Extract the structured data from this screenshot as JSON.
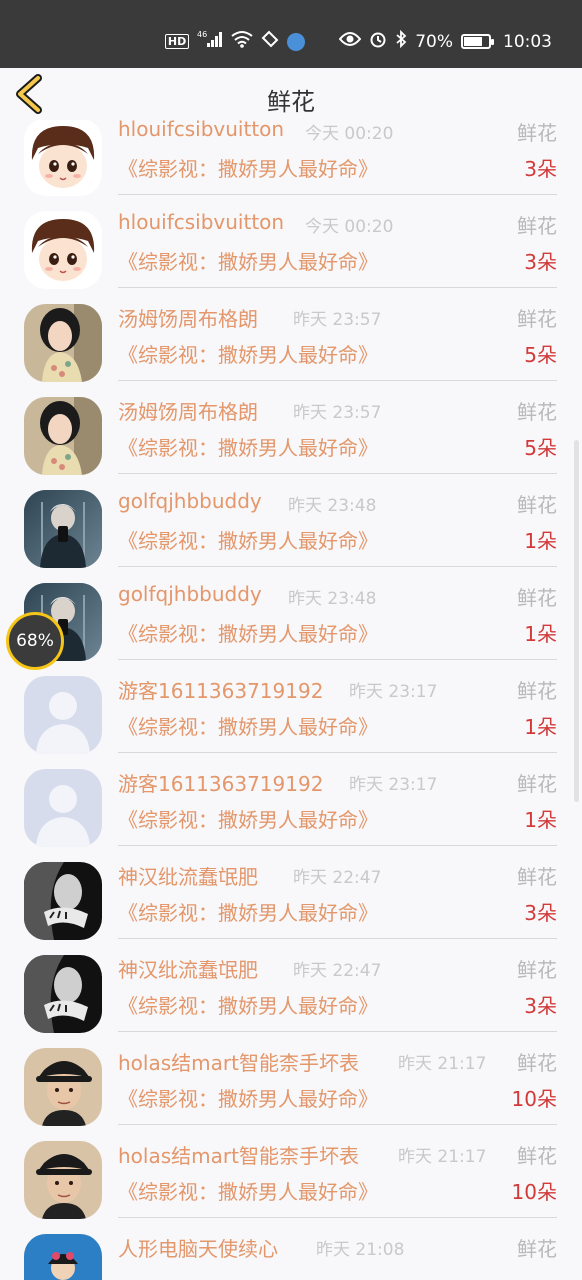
{
  "status_bar": {
    "hd": "HD",
    "net": "46",
    "battery_text": "70%",
    "time": "10:03",
    "battery_level": 0.7
  },
  "nav": {
    "title": "鲜花"
  },
  "overlay": {
    "float_percent": "68%"
  },
  "items": [
    {
      "name": "hlouifcsibvuitton",
      "time": "今天 00:20",
      "gift": "鲜花",
      "book": "《综影视：撒娇男人最好命》",
      "count": "3朵",
      "avatar": "cartoon"
    },
    {
      "name": "hlouifcsibvuitton",
      "time": "今天 00:20",
      "gift": "鲜花",
      "book": "《综影视：撒娇男人最好命》",
      "count": "3朵",
      "avatar": "cartoon"
    },
    {
      "name": "汤姆饧周布格朗",
      "time": "昨天 23:57",
      "gift": "鲜花",
      "book": "《综影视：撒娇男人最好命》",
      "count": "5朵",
      "avatar": "woman"
    },
    {
      "name": "汤姆饧周布格朗",
      "time": "昨天 23:57",
      "gift": "鲜花",
      "book": "《综影视：撒娇男人最好命》",
      "count": "5朵",
      "avatar": "woman"
    },
    {
      "name": "golfqjhbbuddy",
      "time": "昨天 23:48",
      "gift": "鲜花",
      "book": "《综影视：撒娇男人最好命》",
      "count": "1朵",
      "avatar": "mirror"
    },
    {
      "name": "golfqjhbbuddy",
      "time": "昨天 23:48",
      "gift": "鲜花",
      "book": "《综影视：撒娇男人最好命》",
      "count": "1朵",
      "avatar": "mirror"
    },
    {
      "name": "游客1611363719192",
      "time": "昨天 23:17",
      "gift": "鲜花",
      "book": "《综影视：撒娇男人最好命》",
      "count": "1朵",
      "avatar": "default"
    },
    {
      "name": "游客1611363719192",
      "time": "昨天 23:17",
      "gift": "鲜花",
      "book": "《综影视：撒娇男人最好命》",
      "count": "1朵",
      "avatar": "default"
    },
    {
      "name": "神汉纰流蠢氓肥",
      "time": "昨天 22:47",
      "gift": "鲜花",
      "book": "《综影视：撒娇男人最好命》",
      "count": "3朵",
      "avatar": "bw"
    },
    {
      "name": "神汉纰流蠢氓肥",
      "time": "昨天 22:47",
      "gift": "鲜花",
      "book": "《综影视：撒娇男人最好命》",
      "count": "3朵",
      "avatar": "bw"
    },
    {
      "name": "holas结mart智能柰手坏表",
      "time": "昨天 21:17",
      "gift": "鲜花",
      "book": "《综影视：撒娇男人最好命》",
      "count": "10朵",
      "avatar": "hat"
    },
    {
      "name": "holas结mart智能柰手坏表",
      "time": "昨天 21:17",
      "gift": "鲜花",
      "book": "《综影视：撒娇男人最好命》",
      "count": "10朵",
      "avatar": "hat"
    },
    {
      "name": "人形电脑天使续心",
      "time": "昨天 21:08",
      "gift": "鲜花",
      "book": "",
      "count": "",
      "avatar": "blue"
    }
  ]
}
